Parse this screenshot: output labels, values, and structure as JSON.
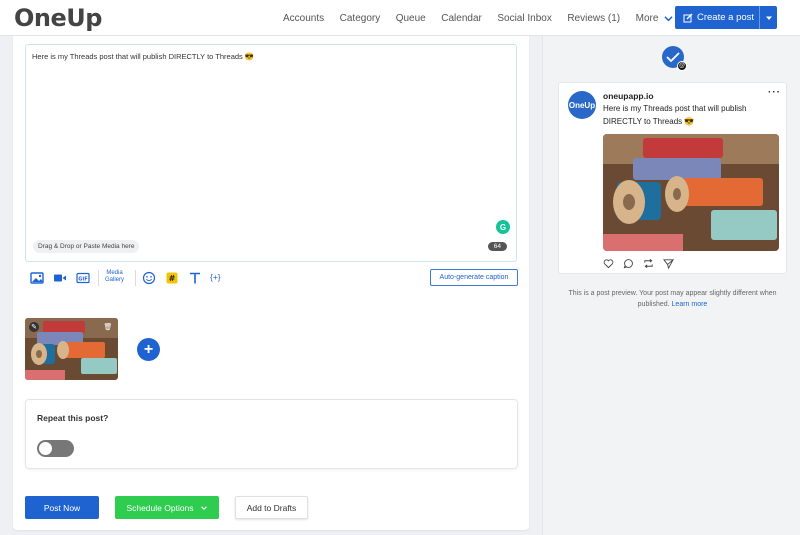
{
  "brand": {
    "logo_text": "OneUp",
    "accent": "#1f63d1",
    "success": "#2ecc4f"
  },
  "nav": {
    "links": [
      "Accounts",
      "Category",
      "Queue",
      "Calendar",
      "Social Inbox",
      "Reviews (1)"
    ],
    "more_label": "More",
    "create_label": "Create a post"
  },
  "composer": {
    "text": "Here is my Threads post that will publish DIRECTLY to Threads 😎",
    "dnd_label": "Drag & Drop or Paste Media here",
    "char_count": "64",
    "media_gallery_label_1": "Media",
    "media_gallery_label_2": "Gallery",
    "variable_label": "{+}",
    "autogen_label": "Auto-generate caption",
    "add_media_symbol": "+"
  },
  "repeat": {
    "title": "Repeat this post?",
    "enabled": false
  },
  "actions": {
    "post_now": "Post Now",
    "schedule": "Schedule Options",
    "drafts": "Add to Drafts"
  },
  "preview": {
    "account_name": "oneupapp.io",
    "avatar_text": "OneUp",
    "more": "···",
    "text": "Here is my Threads post that will publish DIRECTLY to Threads 😎",
    "note": "This is a post preview. Your post may appear slightly different when published.",
    "learn_more": "Learn more"
  }
}
